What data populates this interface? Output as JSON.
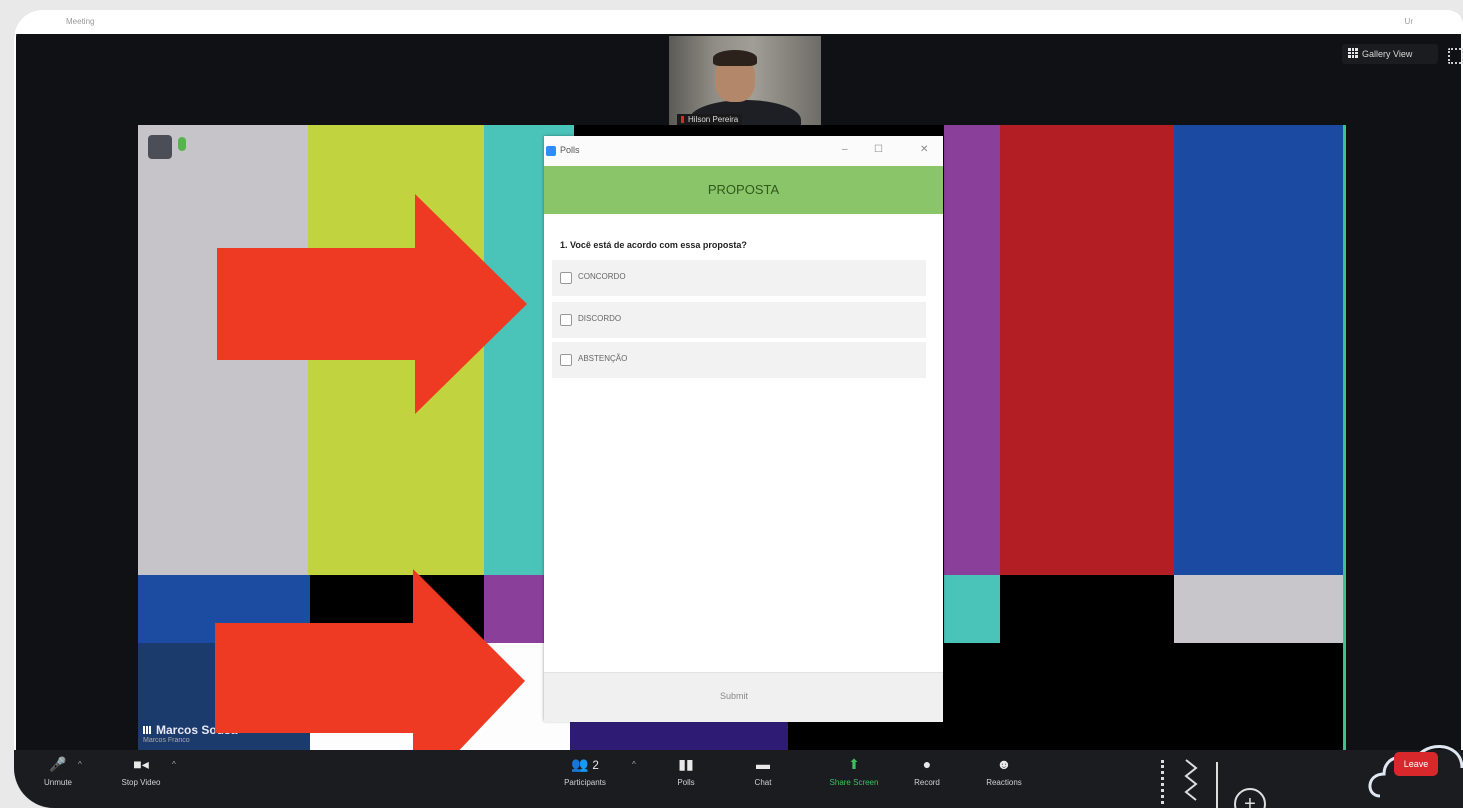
{
  "window": {
    "title": "Meeting",
    "title_right": "Ur"
  },
  "header": {
    "gallery_view": "Gallery View"
  },
  "thumbnail": {
    "name": "Hilson Pereira"
  },
  "shared_screen": {
    "presenter_name": "Marcos Sousa",
    "presenter_sub": "Marcos Franco"
  },
  "polls_window": {
    "title": "Polls",
    "poll_title": "PROPOSTA",
    "question": "1. Você está de acordo com essa proposta?",
    "options": [
      "CONCORDO",
      "DISCORDO",
      "ABSTENÇÃO"
    ],
    "submit": "Submit"
  },
  "toolbar": {
    "unmute": "Unmute",
    "stop_video": "Stop Video",
    "participants": "Participants",
    "participants_count": "2",
    "polls": "Polls",
    "chat": "Chat",
    "share_screen": "Share Screen",
    "record": "Record",
    "reactions": "Reactions",
    "leave": "Leave"
  },
  "colors": {
    "share_accent": "#3cc28a",
    "poll_banner": "#8bc56a",
    "arrow": "#ee3a22",
    "leave": "#d8282c"
  }
}
